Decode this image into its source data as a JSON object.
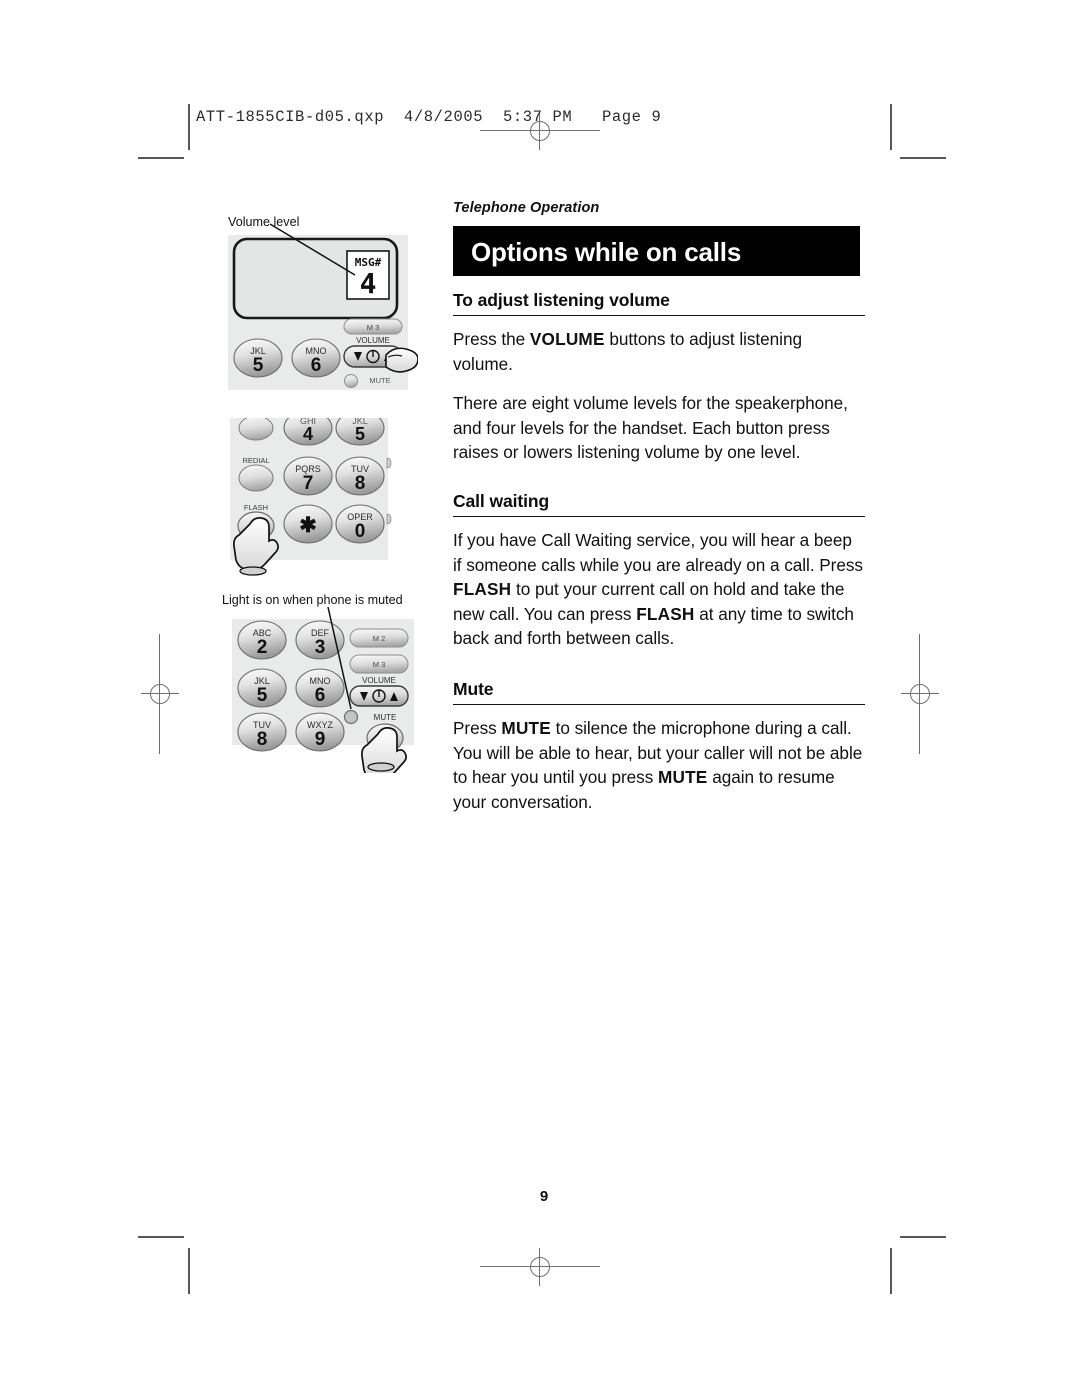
{
  "print_marks": {
    "qxp_header": "ATT-1855CIB-d05.qxp  4/8/2005  5:37 PM   Page 9"
  },
  "page": {
    "kicker": "Telephone Operation",
    "title": "Options while on calls",
    "page_number": "9"
  },
  "sections": [
    {
      "heading": "To adjust listening volume",
      "paragraphs": [
        {
          "runs": [
            {
              "text": "Press the ",
              "bold": false
            },
            {
              "text": "VOLUME",
              "bold": true
            },
            {
              "text": " buttons to adjust listening volume.",
              "bold": false
            }
          ]
        },
        {
          "runs": [
            {
              "text": "There are eight volume levels for the speakerphone, and four levels for the handset. Each button press raises or lowers listening volume by one level.",
              "bold": false
            }
          ]
        }
      ]
    },
    {
      "heading": "Call waiting",
      "paragraphs": [
        {
          "runs": [
            {
              "text": "If you have Call Waiting service, you will hear a beep if someone calls while you are already on a call. Press ",
              "bold": false
            },
            {
              "text": "FLASH",
              "bold": true
            },
            {
              "text": " to put your current call on hold and take the new call. You can press ",
              "bold": false
            },
            {
              "text": "FLASH",
              "bold": true
            },
            {
              "text": " at any time to switch back and forth between calls.",
              "bold": false
            }
          ]
        }
      ]
    },
    {
      "heading": "Mute",
      "paragraphs": [
        {
          "runs": [
            {
              "text": "Press ",
              "bold": false
            },
            {
              "text": "MUTE",
              "bold": true
            },
            {
              "text": " to silence the microphone during a call. You will be able to hear, but your caller will not be able to hear you until you press ",
              "bold": false
            },
            {
              "text": "MUTE",
              "bold": true
            },
            {
              "text": " again to resume your conversation.",
              "bold": false
            }
          ]
        }
      ]
    }
  ],
  "figures": {
    "volume": {
      "callout": "Volume level",
      "display": {
        "label": "MSG#",
        "value": "4"
      },
      "keys": [
        {
          "letters": "JKL",
          "digit": "5"
        },
        {
          "letters": "MNO",
          "digit": "6"
        }
      ],
      "memory_keys": [
        "M 3"
      ],
      "volume_label": "VOLUME",
      "volume_icons": [
        "down-triangle",
        "power",
        "up-triangle"
      ],
      "mute_label": "MUTE"
    },
    "flash": {
      "keys": [
        {
          "letters": "GHI",
          "digit": "4"
        },
        {
          "letters": "JKL",
          "digit": "5"
        },
        {
          "letters": "PQRS",
          "digit": "7"
        },
        {
          "letters": "TUV",
          "digit": "8"
        },
        {
          "letters": "",
          "digit": "✱"
        },
        {
          "letters": "OPER",
          "digit": "0"
        }
      ],
      "function_keys": [
        "REDIAL",
        "FLASH"
      ],
      "pressed_key": "FLASH"
    },
    "mute": {
      "callout": "Light is on when phone is muted",
      "keys": [
        {
          "letters": "ABC",
          "digit": "2"
        },
        {
          "letters": "DEF",
          "digit": "3"
        },
        {
          "letters": "JKL",
          "digit": "5"
        },
        {
          "letters": "MNO",
          "digit": "6"
        },
        {
          "letters": "TUV",
          "digit": "8"
        },
        {
          "letters": "WXYZ",
          "digit": "9"
        }
      ],
      "memory_keys": [
        "M 2",
        "M 3"
      ],
      "volume_label": "VOLUME",
      "mute_label": "MUTE",
      "pressed_key": "MUTE"
    }
  },
  "colors": {
    "title_bar_bg": "#000000",
    "title_bar_fg": "#ffffff",
    "body_text": "#111111",
    "crop_mark": "#58585b",
    "phone_body": "#e8eaea",
    "key_fill_light": "#f4f4f4",
    "key_fill_dark": "#9c9c9c"
  }
}
